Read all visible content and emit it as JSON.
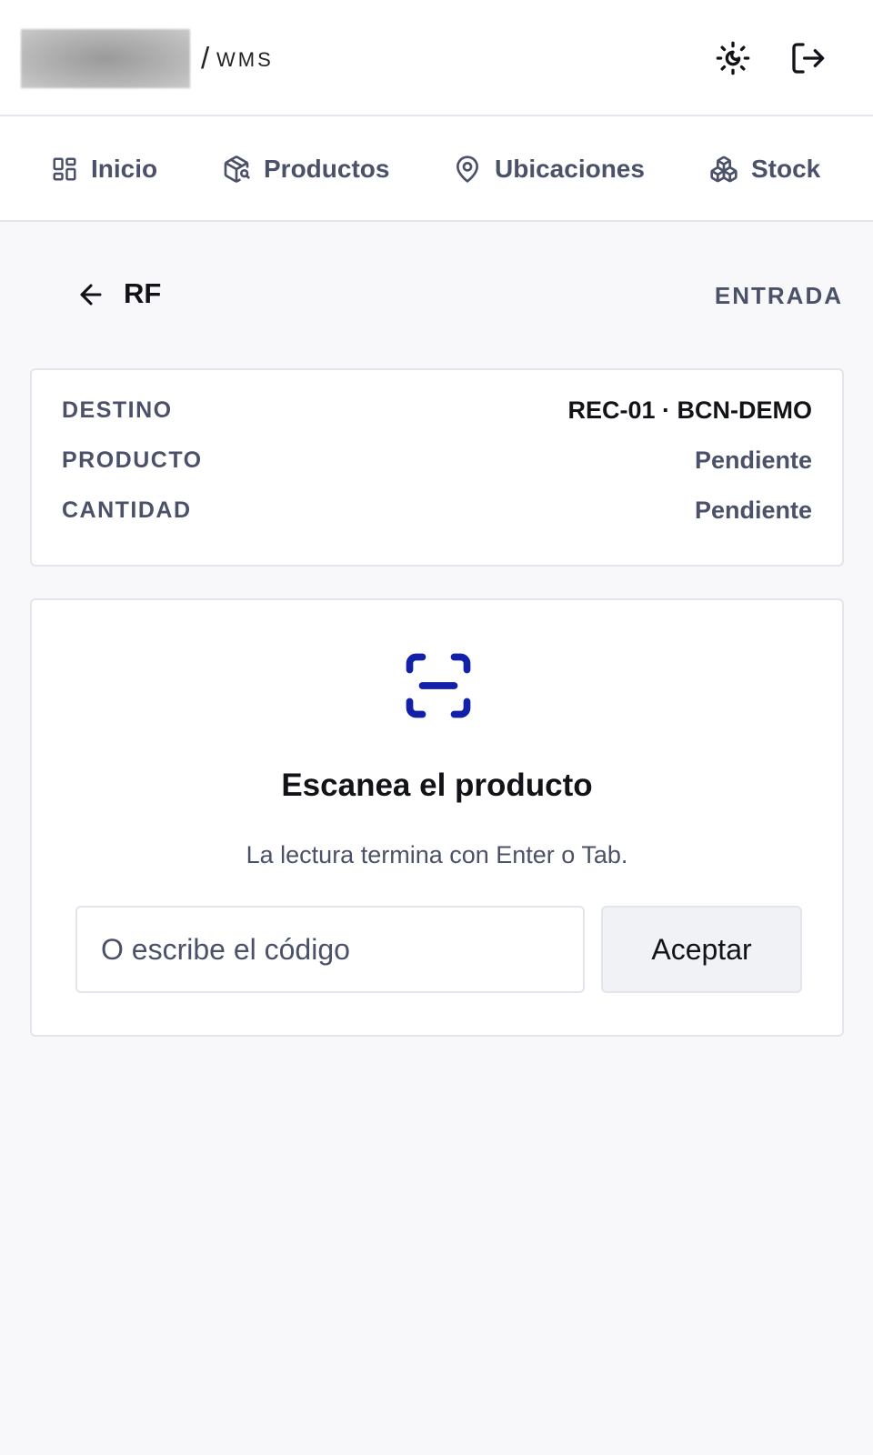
{
  "header": {
    "separator": "/",
    "brand": "WMS",
    "theme_icon": "sun-moon-icon",
    "logout_icon": "logout-icon"
  },
  "nav": {
    "items": [
      {
        "label": "Inicio",
        "icon": "dashboard-icon"
      },
      {
        "label": "Productos",
        "icon": "package-search-icon"
      },
      {
        "label": "Ubicaciones",
        "icon": "map-pin-icon"
      },
      {
        "label": "Stock",
        "icon": "boxes-icon"
      }
    ]
  },
  "page": {
    "title": "RF",
    "mode": "ENTRADA",
    "back_icon": "arrow-left-icon"
  },
  "summary": {
    "rows": [
      {
        "key": "DESTINO",
        "value": "REC-01 · BCN-DEMO"
      },
      {
        "key": "PRODUCTO",
        "value": "Pendiente"
      },
      {
        "key": "CANTIDAD",
        "value": "Pendiente"
      }
    ]
  },
  "scan": {
    "icon": "scan-icon",
    "title": "Escanea el producto",
    "hint": "La lectura termina con Enter o Tab.",
    "input_placeholder": "O escribe el código",
    "input_value": "",
    "accept_label": "Aceptar"
  },
  "colors": {
    "accent": "#1321a8",
    "muted_text": "#4a5168",
    "border": "#e3e5ec",
    "page_bg": "#f8f8fb"
  }
}
